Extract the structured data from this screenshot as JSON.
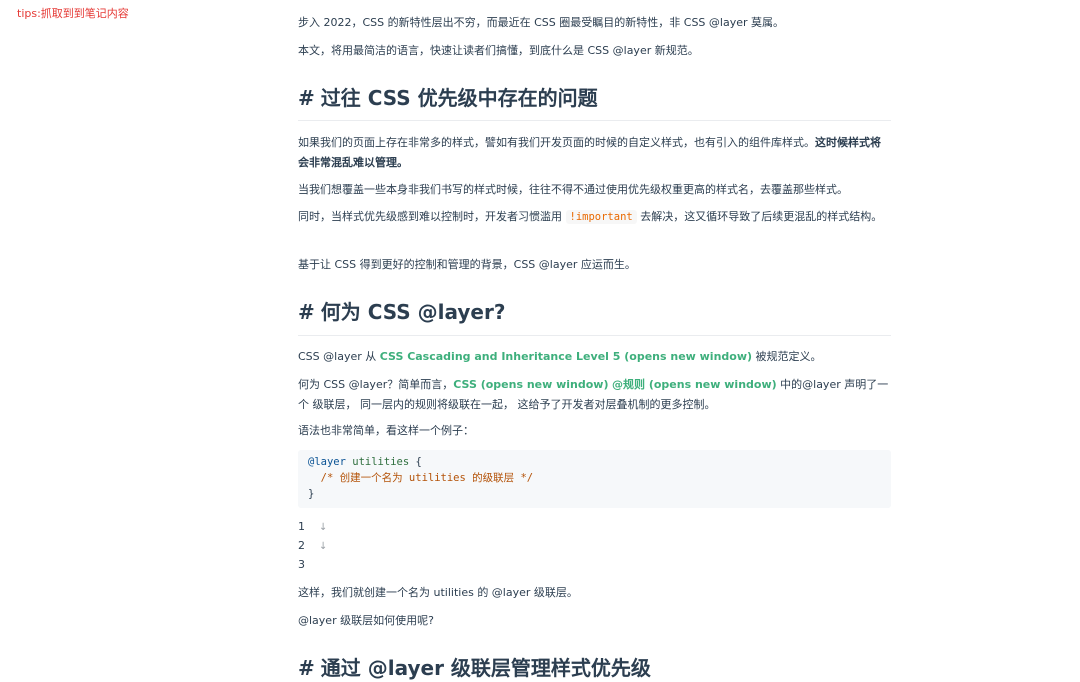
{
  "tips": "tips:抓取到到笔记内容",
  "intro": {
    "p1": "步入 2022，CSS 的新特性层出不穷，而最近在 CSS 圈最受瞩目的新特性，非 CSS @layer 莫属。",
    "p2": "本文，将用最简洁的语言，快速让读者们搞懂，到底什么是 CSS @layer 新规范。"
  },
  "section1": {
    "hash": "#",
    "title": "过往 CSS 优先级中存在的问题",
    "p1_a": "如果我们的页面上存在非常多的样式，譬如有我们开发页面的时候的自定义样式，也有引入的组件库样式。",
    "p1_b": "这时候样式将会非常混乱难以管理",
    "p1_c": "。",
    "p2": "当我们想覆盖一些本身非我们书写的样式时候，往往不得不通过使用优先级权重更高的样式名，去覆盖那些样式。",
    "p3_a": "同时，当样式优先级感到难以控制时，开发者习惯滥用 ",
    "p3_code": "!important",
    "p3_b": " 去解决，这又循环导致了后续更混乱的样式结构。",
    "p4": "基于让 CSS 得到更好的控制和管理的背景，CSS @layer 应运而生。"
  },
  "section2": {
    "hash": "#",
    "title": "何为 CSS @layer?",
    "p1_a": "CSS @layer 从 ",
    "p1_link": "CSS Cascading and Inheritance Level 5 (opens new window)",
    "p1_b": " 被规范定义。",
    "p2_a": "何为 CSS @layer？简单而言，",
    "p2_link1": "CSS (opens new window)",
    "p2_link2": "@规则 (opens new window)",
    "p2_b": " 中的@layer 声明了一个 级联层， 同一层内的规则将级联在一起， 这给予了开发者对层叠机制的更多控制。",
    "p3": "语法也非常简单，看这样一个例子：",
    "code": {
      "l1_kw": "@layer",
      "l1_name": " utilities",
      "l1_rest": " {",
      "l2": "  /* 创建一个名为 utilities 的级联层 */",
      "l3": "}"
    },
    "line_numbers": [
      "1",
      "2",
      "3"
    ],
    "arrow": "↓",
    "p4": "这样，我们就创建一个名为 utilities 的 @layer 级联层。",
    "p5": "@layer 级联层如何使用呢?"
  },
  "section3": {
    "hash": "#",
    "title": "通过 @layer 级联层管理样式优先级"
  }
}
